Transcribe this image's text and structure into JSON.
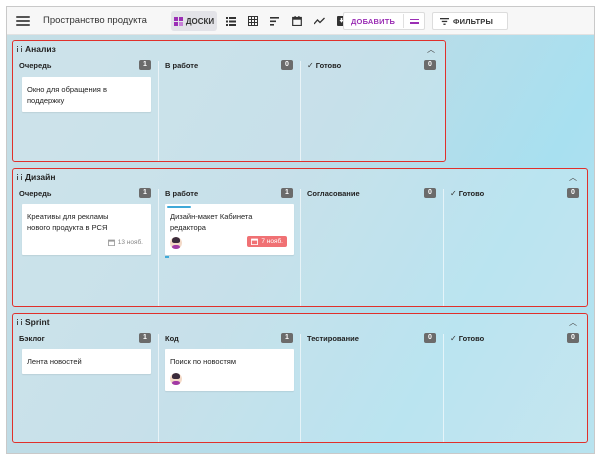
{
  "header": {
    "title": "Пространство продукта",
    "views": [
      {
        "name": "boards",
        "label": "ДОСКИ",
        "active": true
      },
      {
        "name": "list"
      },
      {
        "name": "table"
      },
      {
        "name": "gantt"
      },
      {
        "name": "calendar"
      },
      {
        "name": "chart"
      },
      {
        "name": "archive"
      }
    ],
    "add_label": "ДОБАВИТЬ",
    "filters_label": "ФИЛЬТРЫ"
  },
  "colors": {
    "accent": "#9b2fb5",
    "board_outline": "#e0302b",
    "count_badge": "#6b6b6b",
    "overdue": "#f07174",
    "progress": "#3fa9d8"
  },
  "boards": [
    {
      "title": "Анализ",
      "columns": [
        {
          "name": "Очередь",
          "count": "1"
        },
        {
          "name": "В работе",
          "count": "0"
        },
        {
          "name": "Готово",
          "count": "0",
          "done": true
        }
      ],
      "cards": [
        {
          "text_1": "Окно для обращения в",
          "text_2": "поддержку"
        }
      ]
    },
    {
      "title": "Дизайн",
      "columns": [
        {
          "name": "Очередь",
          "count": "1"
        },
        {
          "name": "В работе",
          "count": "1"
        },
        {
          "name": "Согласование",
          "count": "0"
        },
        {
          "name": "Готово",
          "count": "0",
          "done": true
        }
      ],
      "cards": [
        {
          "text_1": "Креативы для рекламы",
          "text_2": "нового продукта в РСЯ",
          "date": "13 нояб."
        },
        {
          "text_1": "Дизайн-макет Кабинета",
          "text_2": "редактора",
          "date": "7 нояб.",
          "overdue": true
        }
      ]
    },
    {
      "title": "Sprint",
      "columns": [
        {
          "name": "Бэклог",
          "count": "1"
        },
        {
          "name": "Код",
          "count": "1"
        },
        {
          "name": "Тестирование",
          "count": "0"
        },
        {
          "name": "Готово",
          "count": "0",
          "done": true
        }
      ],
      "cards": [
        {
          "text_1": "Лента новостей"
        },
        {
          "text_1": "Поиск по новостям"
        }
      ]
    }
  ]
}
